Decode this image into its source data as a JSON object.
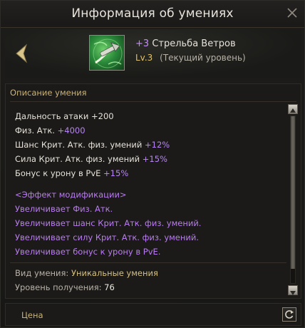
{
  "window": {
    "title": "Информация об умениях"
  },
  "skill": {
    "plus": "+3",
    "name": "Стрельба Ветров",
    "level": "Lv.3",
    "level_note": "(Текущий уровень)"
  },
  "description": {
    "header": "Описание умения",
    "stats": [
      {
        "label": "Дальность атаки +200",
        "value": ""
      },
      {
        "label": "Физ. Атк.",
        "value": "+4000"
      },
      {
        "label": "Шанс Крит. Атк. физ. умений",
        "value": "+12%"
      },
      {
        "label": "Сила Крит. Атк. физ. умений",
        "value": "+15%"
      },
      {
        "label": "Бонус к урону в PvE",
        "value": "+15%"
      }
    ],
    "modification": {
      "title": "<Эффект модификации>",
      "lines": [
        "Увеличивает Физ. Атк.",
        "Увеличивает шанс Крит. Атк. физ. умений.",
        "Увеличивает силу Крит. Атк. физ. умений.",
        "Увеличивает бонус к урону в PvE."
      ]
    },
    "skill_type_label": "Вид умения:",
    "skill_type_value": "Уникальные умения",
    "acquire_level_label": "Уровень получения:",
    "acquire_level_value": "76"
  },
  "price": {
    "label": "Цена"
  },
  "scroll": {
    "position": 0
  },
  "icons": {
    "close": "close-icon",
    "back": "arrow-left-icon",
    "skill": "skill-crossbow-icon",
    "scroll_up": "scroll-up-icon",
    "scroll_down": "scroll-down-icon",
    "refresh": "refresh-icon"
  },
  "colors": {
    "purple": "#b784f5",
    "gold": "#d6c07c",
    "header_gold": "#c9b37a"
  }
}
